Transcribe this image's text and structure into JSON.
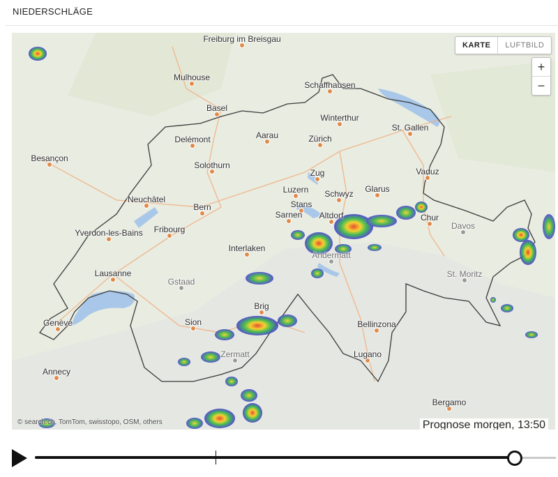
{
  "header": {
    "title": "NIEDERSCHLÄGE"
  },
  "map": {
    "toggle": {
      "active": "KARTE",
      "inactive": "LUFTBILD"
    },
    "zoom": {
      "in": "+",
      "out": "−"
    },
    "cities": [
      "Freiburg im Breisgau",
      "Mulhouse",
      "Schaffhausen",
      "Basel",
      "Winterthur",
      "St. Gallen",
      "Delémont",
      "Aarau",
      "Zürich",
      "Besançon",
      "Solothurn",
      "Vaduz",
      "Zug",
      "Luzern",
      "Schwyz",
      "Glarus",
      "Neuchâtel",
      "Bern",
      "Stans",
      "Sarnen",
      "Altdorf",
      "Chur",
      "Davos",
      "Yverdon-les-Bains",
      "Fribourg",
      "Interlaken",
      "Andermatt",
      "Lausanne",
      "St. Moritz",
      "Gstaad",
      "Brig",
      "Genève",
      "Sion",
      "Bellinzona",
      "Zermatt",
      "Annecy",
      "Lugano",
      "Bergamo"
    ],
    "attribution": "© search.ch, TomTom, swisstopo, OSM, others",
    "forecast_label": "Prognose morgen, 13:50"
  },
  "player": {
    "progress": 0.99,
    "marker": 0.37
  }
}
